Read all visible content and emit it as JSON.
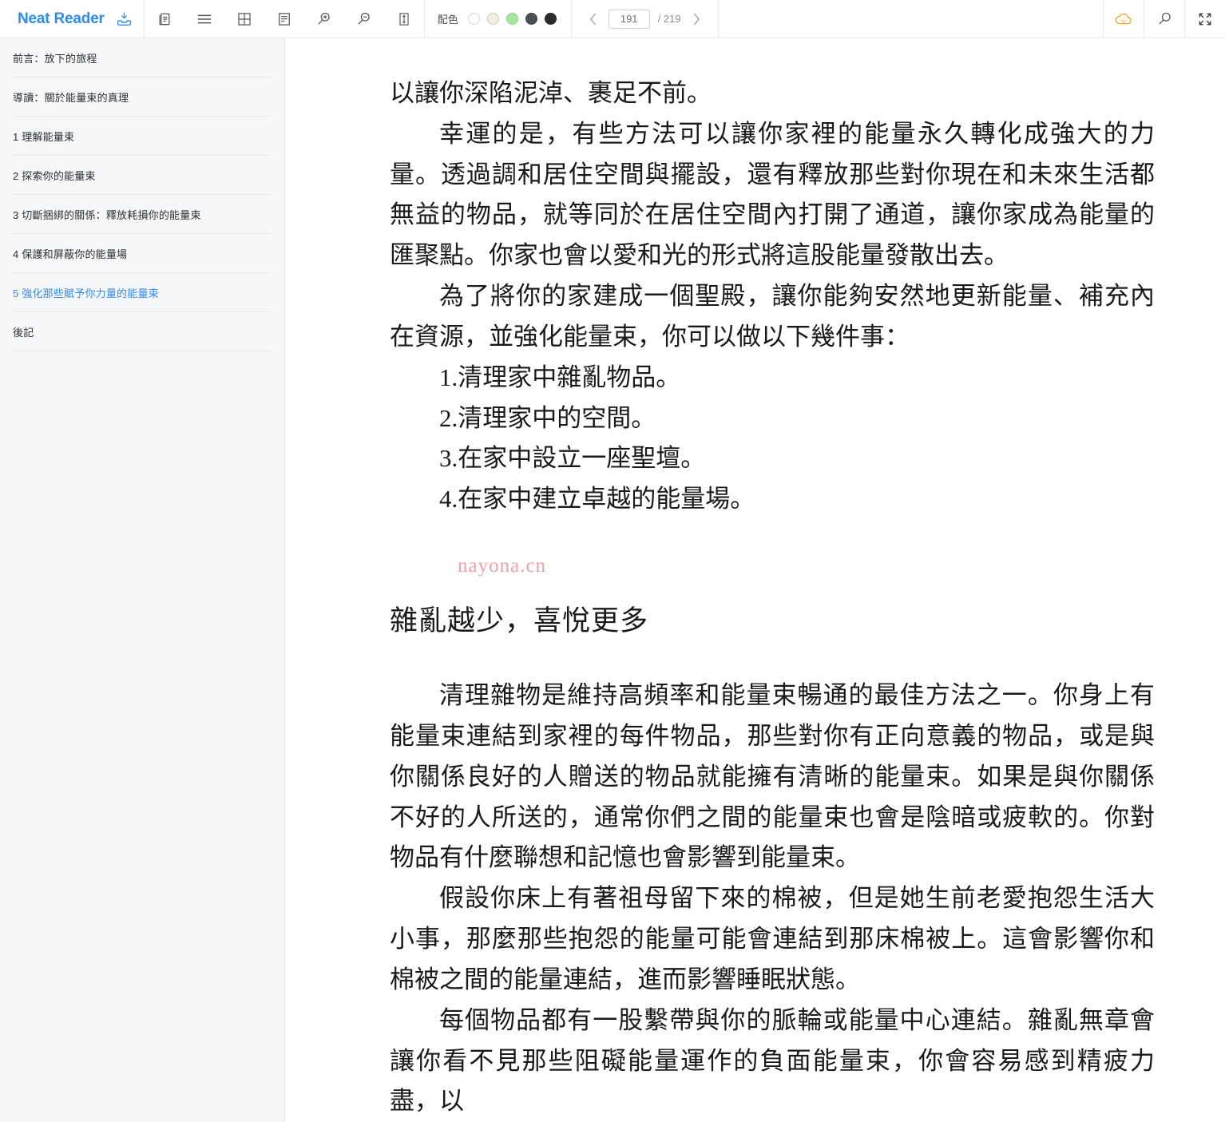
{
  "app": {
    "brand": "Neat Reader"
  },
  "toolbar": {
    "save_icon": "save-to-library-icon",
    "tools": [
      {
        "name": "two-page-layout-icon",
        "label": "two-page-layout"
      },
      {
        "name": "table-of-contents-icon",
        "label": "table-of-contents"
      },
      {
        "name": "grid-layout-icon",
        "label": "grid-layout"
      },
      {
        "name": "notes-panel-icon",
        "label": "notes-panel"
      },
      {
        "name": "zoom-in-icon",
        "label": "zoom-in"
      },
      {
        "name": "zoom-out-icon",
        "label": "zoom-out"
      },
      {
        "name": "line-height-icon",
        "label": "line-height"
      }
    ],
    "palette": {
      "label": "配色",
      "swatches": [
        {
          "name": "theme-white",
          "color": "#ffffff"
        },
        {
          "name": "theme-cream",
          "color": "#f3 efe1"
        },
        {
          "name": "theme-green",
          "color": "#a8e3a0"
        },
        {
          "name": "theme-dark-gray",
          "color": "#4a4f52"
        },
        {
          "name": "theme-black",
          "color": "#2a2d2f"
        }
      ]
    },
    "pager": {
      "prev_label": "‹",
      "next_label": "›",
      "current_page": "191",
      "total_label": "/ 219"
    },
    "right_tools": [
      {
        "name": "cloud-sync-icon",
        "label": "cloud-sync",
        "color": "#f5a623"
      },
      {
        "name": "search-icon",
        "label": "search"
      },
      {
        "name": "fullscreen-icon",
        "label": "fullscreen"
      }
    ]
  },
  "sidebar": {
    "items": [
      {
        "label": "前言：放下的旅程",
        "active": false
      },
      {
        "label": "導讀：關於能量束的真理",
        "active": false
      },
      {
        "label": "1 理解能量束",
        "active": false
      },
      {
        "label": "2 探索你的能量束",
        "active": false
      },
      {
        "label": "3 切斷捆綁的關係：釋放耗損你的能量束",
        "active": false
      },
      {
        "label": "4 保護和屏蔽你的能量場",
        "active": false
      },
      {
        "label": "5 強化那些賦予你力量的能量束",
        "active": true
      },
      {
        "label": "後記",
        "active": false
      }
    ]
  },
  "content": {
    "paragraphs": [
      "以讓你深陷泥淖、裹足不前。",
      "幸運的是，有些方法可以讓你家裡的能量永久轉化成強大的力量。透過調和居住空間與擺設，還有釋放那些對你現在和未來生活都無益的物品，就等同於在居住空間內打開了通道，讓你家成為能量的匯聚點。你家也會以愛和光的形式將這股能量發散出去。",
      "為了將你的家建成一個聖殿，讓你能夠安然地更新能量、補充內在資源，並強化能量束，你可以做以下幾件事："
    ],
    "list_items": [
      "1.清理家中雜亂物品。",
      "2.清理家中的空間。",
      "3.在家中設立一座聖壇。",
      "4.在家中建立卓越的能量場。"
    ],
    "watermark": "nayona.cn",
    "heading": "雜亂越少，喜悅更多",
    "paragraphs_after": [
      "清理雜物是維持高頻率和能量束暢通的最佳方法之一。你身上有能量束連結到家裡的每件物品，那些對你有正向意義的物品，或是與你關係良好的人贈送的物品就能擁有清晰的能量束。如果是與你關係不好的人所送的，通常你們之間的能量束也會是陰暗或疲軟的。你對物品有什麼聯想和記憶也會影響到能量束。",
      "假設你床上有著祖母留下來的棉被，但是她生前老愛抱怨生活大小事，那麼那些抱怨的能量可能會連結到那床棉被上。這會影響你和棉被之間的能量連結，進而影響睡眠狀態。",
      "每個物品都有一股繫帶與你的脈輪或能量中心連結。雜亂無章會讓你看不見那些阻礙能量運作的負面能量束，你會容易感到精疲力盡，以"
    ]
  },
  "colors": {
    "brand_blue": "#2b8cf0",
    "sidebar_bg": "#f6f7f9",
    "watermark": "#f0a3a3",
    "cloud_orange": "#f5a623"
  }
}
